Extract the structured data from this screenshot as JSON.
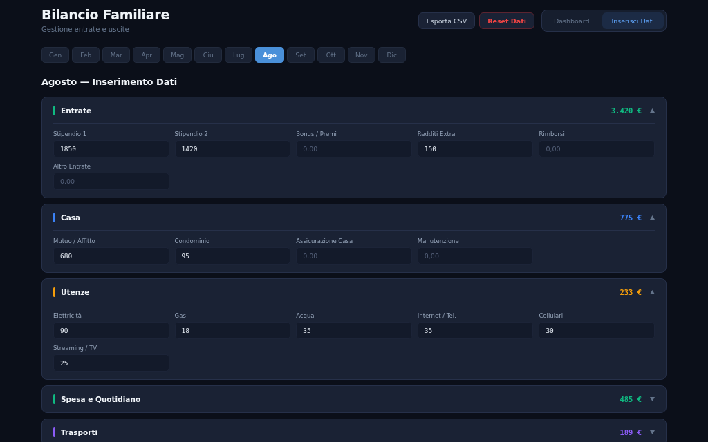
{
  "header": {
    "title": "Bilancio Familiare",
    "subtitle": "Gestione entrate e uscite"
  },
  "actions": [
    {
      "label": "Esporta CSV",
      "kind": "default"
    },
    {
      "label": "Reset Dati",
      "kind": "danger"
    }
  ],
  "views": [
    {
      "label": "Dashboard",
      "selected": false
    },
    {
      "label": "Inserisci Dati",
      "selected": true
    }
  ],
  "months": [
    {
      "label": "Gen",
      "selected": false
    },
    {
      "label": "Feb",
      "selected": false
    },
    {
      "label": "Mar",
      "selected": false
    },
    {
      "label": "Apr",
      "selected": false
    },
    {
      "label": "Mag",
      "selected": false
    },
    {
      "label": "Giu",
      "selected": false
    },
    {
      "label": "Lug",
      "selected": false
    },
    {
      "label": "Ago",
      "selected": true
    },
    {
      "label": "Set",
      "selected": false
    },
    {
      "label": "Ott",
      "selected": false
    },
    {
      "label": "Nov",
      "selected": false
    },
    {
      "label": "Dic",
      "selected": false
    }
  ],
  "section_title": "Agosto — Inserimento Dati",
  "categories": [
    {
      "name": "Entrate",
      "total": "3.420 €",
      "color": "#10b981",
      "expanded": true,
      "fields": [
        {
          "label": "Stipendio 1",
          "value": "1850"
        },
        {
          "label": "Stipendio 2",
          "value": "1420"
        },
        {
          "label": "Bonus / Premi",
          "placeholder": "0,00"
        },
        {
          "label": "Redditi Extra",
          "value": "150"
        },
        {
          "label": "Rimborsi",
          "placeholder": "0,00"
        },
        {
          "label": "Altro Entrate",
          "placeholder": "0,00"
        }
      ]
    },
    {
      "name": "Casa",
      "total": "775 €",
      "color": "#3b82f6",
      "expanded": true,
      "fields": [
        {
          "label": "Mutuo / Affitto",
          "value": "680"
        },
        {
          "label": "Condominio",
          "value": "95"
        },
        {
          "label": "Assicurazione Casa",
          "placeholder": "0,00"
        },
        {
          "label": "Manutenzione",
          "placeholder": "0,00"
        }
      ]
    },
    {
      "name": "Utenze",
      "total": "233 €",
      "color": "#f59e0b",
      "expanded": true,
      "fields": [
        {
          "label": "Elettricità",
          "value": "90"
        },
        {
          "label": "Gas",
          "value": "18"
        },
        {
          "label": "Acqua",
          "value": "35"
        },
        {
          "label": "Internet / Tel.",
          "value": "35"
        },
        {
          "label": "Cellulari",
          "value": "30"
        },
        {
          "label": "Streaming / TV",
          "value": "25"
        }
      ]
    },
    {
      "name": "Spesa e Quotidiano",
      "total": "485 €",
      "color": "#10b981",
      "expanded": false
    },
    {
      "name": "Trasporti",
      "total": "189 €",
      "color": "#8b5cf6",
      "expanded": false
    }
  ]
}
